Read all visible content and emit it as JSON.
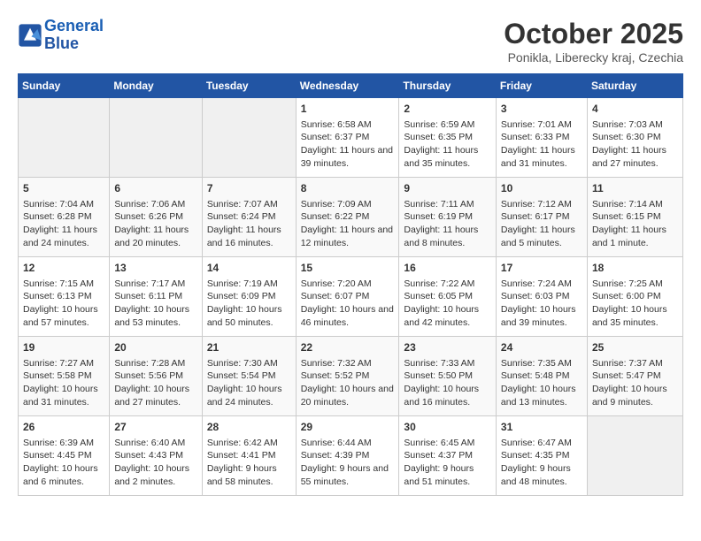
{
  "header": {
    "logo_line1": "General",
    "logo_line2": "Blue",
    "month_title": "October 2025",
    "subtitle": "Ponikla, Liberecky kraj, Czechia"
  },
  "days_of_week": [
    "Sunday",
    "Monday",
    "Tuesday",
    "Wednesday",
    "Thursday",
    "Friday",
    "Saturday"
  ],
  "weeks": [
    [
      {
        "day": "",
        "content": ""
      },
      {
        "day": "",
        "content": ""
      },
      {
        "day": "",
        "content": ""
      },
      {
        "day": "1",
        "content": "Sunrise: 6:58 AM\nSunset: 6:37 PM\nDaylight: 11 hours and 39 minutes."
      },
      {
        "day": "2",
        "content": "Sunrise: 6:59 AM\nSunset: 6:35 PM\nDaylight: 11 hours and 35 minutes."
      },
      {
        "day": "3",
        "content": "Sunrise: 7:01 AM\nSunset: 6:33 PM\nDaylight: 11 hours and 31 minutes."
      },
      {
        "day": "4",
        "content": "Sunrise: 7:03 AM\nSunset: 6:30 PM\nDaylight: 11 hours and 27 minutes."
      }
    ],
    [
      {
        "day": "5",
        "content": "Sunrise: 7:04 AM\nSunset: 6:28 PM\nDaylight: 11 hours and 24 minutes."
      },
      {
        "day": "6",
        "content": "Sunrise: 7:06 AM\nSunset: 6:26 PM\nDaylight: 11 hours and 20 minutes."
      },
      {
        "day": "7",
        "content": "Sunrise: 7:07 AM\nSunset: 6:24 PM\nDaylight: 11 hours and 16 minutes."
      },
      {
        "day": "8",
        "content": "Sunrise: 7:09 AM\nSunset: 6:22 PM\nDaylight: 11 hours and 12 minutes."
      },
      {
        "day": "9",
        "content": "Sunrise: 7:11 AM\nSunset: 6:19 PM\nDaylight: 11 hours and 8 minutes."
      },
      {
        "day": "10",
        "content": "Sunrise: 7:12 AM\nSunset: 6:17 PM\nDaylight: 11 hours and 5 minutes."
      },
      {
        "day": "11",
        "content": "Sunrise: 7:14 AM\nSunset: 6:15 PM\nDaylight: 11 hours and 1 minute."
      }
    ],
    [
      {
        "day": "12",
        "content": "Sunrise: 7:15 AM\nSunset: 6:13 PM\nDaylight: 10 hours and 57 minutes."
      },
      {
        "day": "13",
        "content": "Sunrise: 7:17 AM\nSunset: 6:11 PM\nDaylight: 10 hours and 53 minutes."
      },
      {
        "day": "14",
        "content": "Sunrise: 7:19 AM\nSunset: 6:09 PM\nDaylight: 10 hours and 50 minutes."
      },
      {
        "day": "15",
        "content": "Sunrise: 7:20 AM\nSunset: 6:07 PM\nDaylight: 10 hours and 46 minutes."
      },
      {
        "day": "16",
        "content": "Sunrise: 7:22 AM\nSunset: 6:05 PM\nDaylight: 10 hours and 42 minutes."
      },
      {
        "day": "17",
        "content": "Sunrise: 7:24 AM\nSunset: 6:03 PM\nDaylight: 10 hours and 39 minutes."
      },
      {
        "day": "18",
        "content": "Sunrise: 7:25 AM\nSunset: 6:00 PM\nDaylight: 10 hours and 35 minutes."
      }
    ],
    [
      {
        "day": "19",
        "content": "Sunrise: 7:27 AM\nSunset: 5:58 PM\nDaylight: 10 hours and 31 minutes."
      },
      {
        "day": "20",
        "content": "Sunrise: 7:28 AM\nSunset: 5:56 PM\nDaylight: 10 hours and 27 minutes."
      },
      {
        "day": "21",
        "content": "Sunrise: 7:30 AM\nSunset: 5:54 PM\nDaylight: 10 hours and 24 minutes."
      },
      {
        "day": "22",
        "content": "Sunrise: 7:32 AM\nSunset: 5:52 PM\nDaylight: 10 hours and 20 minutes."
      },
      {
        "day": "23",
        "content": "Sunrise: 7:33 AM\nSunset: 5:50 PM\nDaylight: 10 hours and 16 minutes."
      },
      {
        "day": "24",
        "content": "Sunrise: 7:35 AM\nSunset: 5:48 PM\nDaylight: 10 hours and 13 minutes."
      },
      {
        "day": "25",
        "content": "Sunrise: 7:37 AM\nSunset: 5:47 PM\nDaylight: 10 hours and 9 minutes."
      }
    ],
    [
      {
        "day": "26",
        "content": "Sunrise: 6:39 AM\nSunset: 4:45 PM\nDaylight: 10 hours and 6 minutes."
      },
      {
        "day": "27",
        "content": "Sunrise: 6:40 AM\nSunset: 4:43 PM\nDaylight: 10 hours and 2 minutes."
      },
      {
        "day": "28",
        "content": "Sunrise: 6:42 AM\nSunset: 4:41 PM\nDaylight: 9 hours and 58 minutes."
      },
      {
        "day": "29",
        "content": "Sunrise: 6:44 AM\nSunset: 4:39 PM\nDaylight: 9 hours and 55 minutes."
      },
      {
        "day": "30",
        "content": "Sunrise: 6:45 AM\nSunset: 4:37 PM\nDaylight: 9 hours and 51 minutes."
      },
      {
        "day": "31",
        "content": "Sunrise: 6:47 AM\nSunset: 4:35 PM\nDaylight: 9 hours and 48 minutes."
      },
      {
        "day": "",
        "content": ""
      }
    ]
  ]
}
